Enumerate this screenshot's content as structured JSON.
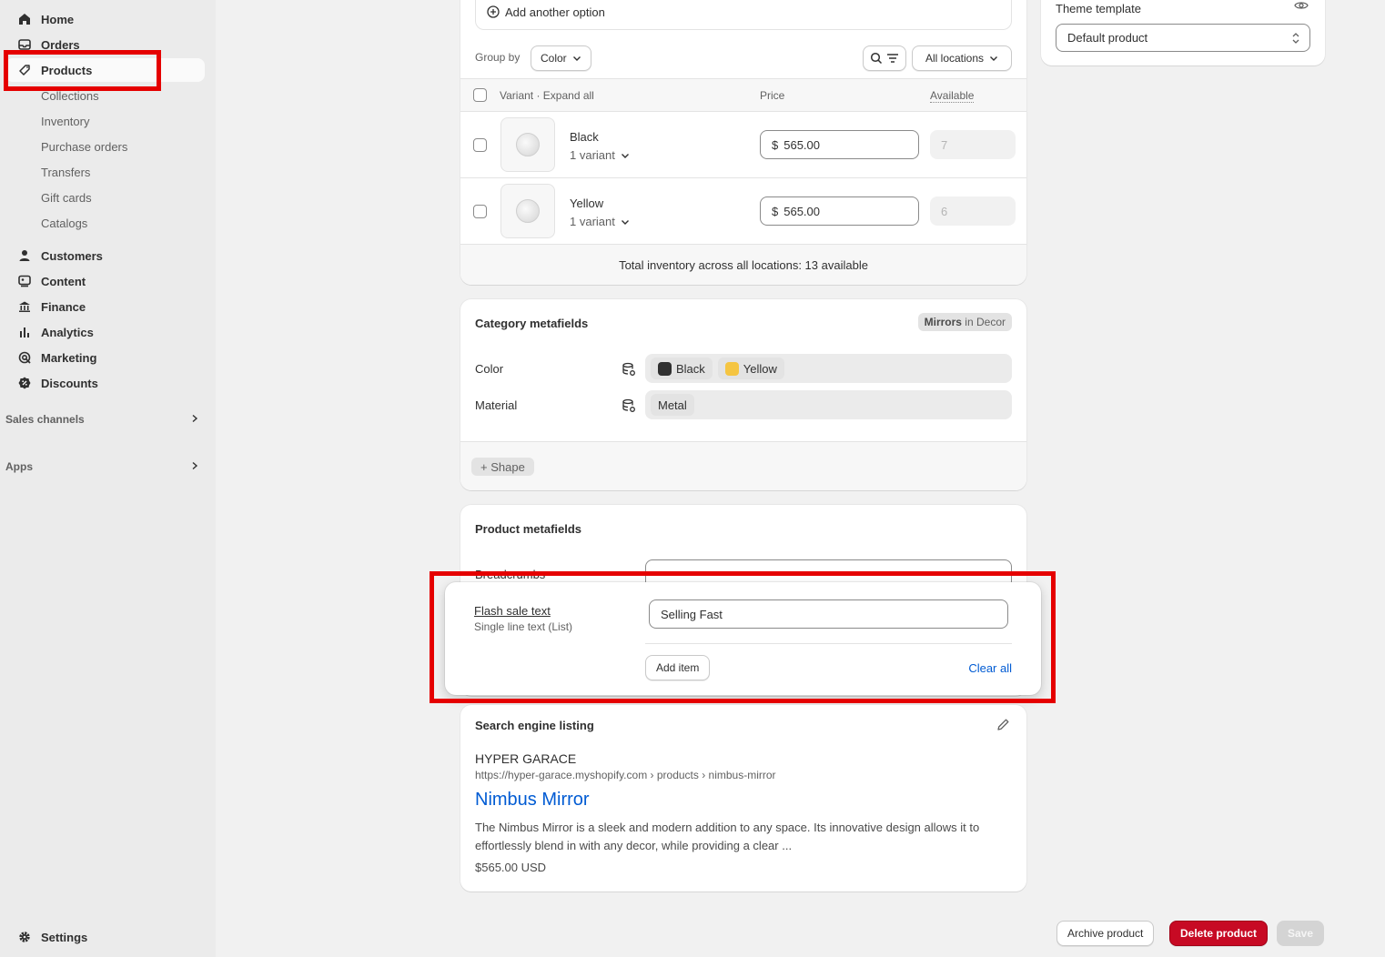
{
  "sidebar": {
    "nav": [
      {
        "label": "Home",
        "icon": "home-icon"
      },
      {
        "label": "Orders",
        "icon": "inbox-icon"
      },
      {
        "label": "Products",
        "icon": "tag-icon"
      }
    ],
    "products_sub": [
      "Collections",
      "Inventory",
      "Purchase orders",
      "Transfers",
      "Gift cards",
      "Catalogs"
    ],
    "nav2": [
      {
        "label": "Customers",
        "icon": "person-icon"
      },
      {
        "label": "Content",
        "icon": "content-icon"
      },
      {
        "label": "Finance",
        "icon": "bank-icon"
      },
      {
        "label": "Analytics",
        "icon": "bar-chart-icon"
      },
      {
        "label": "Marketing",
        "icon": "target-icon"
      },
      {
        "label": "Discounts",
        "icon": "discount-icon"
      }
    ],
    "sales_channels": "Sales channels",
    "apps": "Apps",
    "settings": "Settings"
  },
  "variants": {
    "add_option": "Add another option",
    "group_by_label": "Group by",
    "group_by_value": "Color",
    "locations": "All locations",
    "header_variant": "Variant · Expand all",
    "header_price": "Price",
    "header_available": "Available",
    "rows": [
      {
        "name": "Black",
        "count": "1 variant",
        "currency": "$",
        "price": "565.00",
        "available": "7"
      },
      {
        "name": "Yellow",
        "count": "1 variant",
        "currency": "$",
        "price": "565.00",
        "available": "6"
      }
    ],
    "total": "Total inventory across all locations: 13 available"
  },
  "category_metafields": {
    "title": "Category metafields",
    "badge_bold": "Mirrors",
    "badge_rest": " in Decor",
    "color_label": "Color",
    "color_chips": [
      {
        "label": "Black",
        "color": "#303030"
      },
      {
        "label": "Yellow",
        "color": "#f5c542"
      }
    ],
    "material_label": "Material",
    "material_chip": "Metal",
    "add_shape": "+ Shape"
  },
  "product_metafields": {
    "title": "Product metafields",
    "partial_label": "Breadcrumbs",
    "flash_label": "Flash sale text",
    "flash_type": "Single line text (List)",
    "flash_value": "Selling Fast",
    "add_item": "Add item",
    "clear_all": "Clear all"
  },
  "seo": {
    "title": "Search engine listing",
    "store": "HYPER GARACE",
    "url": "https://hyper-garace.myshopify.com › products › nimbus-mirror",
    "page_title": "Nimbus Mirror",
    "description": "The Nimbus Mirror is a sleek and modern addition to any space. Its innovative design allows it to effortlessly blend in with any decor, while providing a clear ...",
    "price": "$565.00 USD"
  },
  "theme": {
    "label": "Theme template",
    "value": "Default product"
  },
  "footer": {
    "archive": "Archive product",
    "delete": "Delete product",
    "save": "Save"
  },
  "colors": {
    "highlight": "#e50000",
    "link": "#005bd3",
    "danger": "#c70a24"
  }
}
